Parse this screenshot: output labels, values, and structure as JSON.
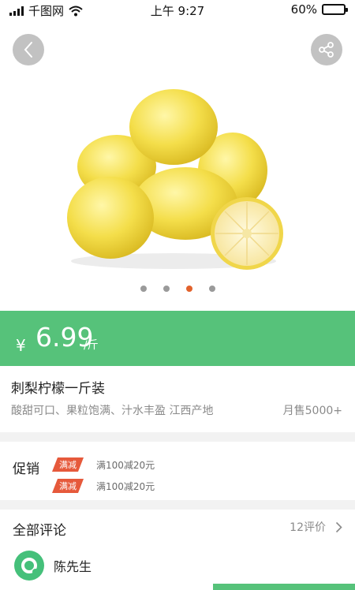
{
  "status_bar": {
    "carrier": "千图网",
    "time": "上午 9:27",
    "battery_percent": "60%",
    "battery_level": 0.6
  },
  "hero": {
    "back_icon": "chevron-left-icon",
    "share_icon": "share-icon",
    "product_image": "lemons-photo",
    "carousel": {
      "count": 4,
      "active_index": 2
    }
  },
  "price": {
    "currency": "¥",
    "value": "6.99",
    "unit": "/斤",
    "band_color": "#56c27a"
  },
  "product": {
    "name": "刺梨柠檬一斤装",
    "description": "酸甜可口、果粒饱满、汁水丰盈   江西产地",
    "monthly_sales": "月售5000+"
  },
  "promotion": {
    "label": "促销",
    "items": [
      {
        "tag": "满减",
        "text": "满100减20元"
      },
      {
        "tag": "满减",
        "text": "满100减20元"
      }
    ],
    "tag_color": "#e6593b"
  },
  "reviews": {
    "title": "全部评论",
    "count": "12评价",
    "chevron_icon": "chevron-right-icon",
    "first_reviewer": "陈先生"
  },
  "colors": {
    "accent": "#56c27a",
    "active_dot": "#e2622c"
  }
}
